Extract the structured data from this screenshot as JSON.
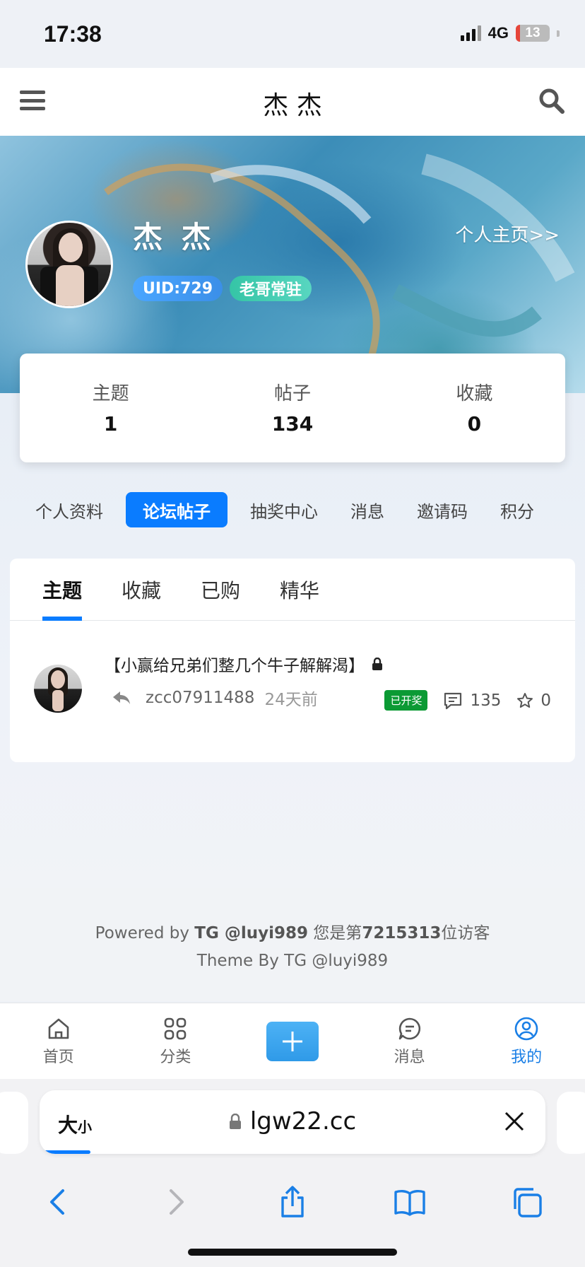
{
  "status_bar": {
    "time": "17:38",
    "network": "4G",
    "battery": "13",
    "battery_level": 0.13
  },
  "header": {
    "title": "杰 杰"
  },
  "profile": {
    "name": "杰 杰",
    "home_link": "个人主页>>",
    "uid": "UID:729",
    "rank": "老哥常驻",
    "stats": [
      {
        "label": "主题",
        "value": "1"
      },
      {
        "label": "帖子",
        "value": "134"
      },
      {
        "label": "收藏",
        "value": "0"
      }
    ]
  },
  "nav_tabs": [
    {
      "label": "个人资料",
      "active": false
    },
    {
      "label": "论坛帖子",
      "active": true
    },
    {
      "label": "抽奖中心",
      "active": false
    },
    {
      "label": "消息",
      "active": false
    },
    {
      "label": "邀请码",
      "active": false
    },
    {
      "label": "积分",
      "active": false
    }
  ],
  "sub_tabs": [
    {
      "label": "主题",
      "active": true
    },
    {
      "label": "收藏",
      "active": false
    },
    {
      "label": "已购",
      "active": false
    },
    {
      "label": "精华",
      "active": false
    }
  ],
  "threads": [
    {
      "title": "【小赢给兄弟们整几个牛子解解渴】",
      "author": "zcc07911488",
      "time": "24天前",
      "badge": "已开奖",
      "comments": "135",
      "favorites": "0"
    }
  ],
  "footer": {
    "powered_prefix": "Powered by ",
    "powered_name": "TG @luyi989",
    "visitor_prefix": " 您是第",
    "visitor_count": "7215313",
    "visitor_suffix": "位访客",
    "theme": "Theme By TG @luyi989"
  },
  "app_nav": [
    {
      "label": "首页",
      "icon": "home-icon"
    },
    {
      "label": "分类",
      "icon": "grid-icon"
    },
    {
      "label": "",
      "icon": "plus-icon"
    },
    {
      "label": "消息",
      "icon": "chat-icon"
    },
    {
      "label": "我的",
      "icon": "user-icon"
    }
  ],
  "browser": {
    "text_size_big": "大",
    "text_size_small": "小",
    "url": "lgw22.cc",
    "load_progress": 0.1
  },
  "colors": {
    "accent": "#0a7cff",
    "success": "#0b9a34",
    "uid_badge": "#3b8fe8",
    "rank_badge": "#35c5a6"
  }
}
